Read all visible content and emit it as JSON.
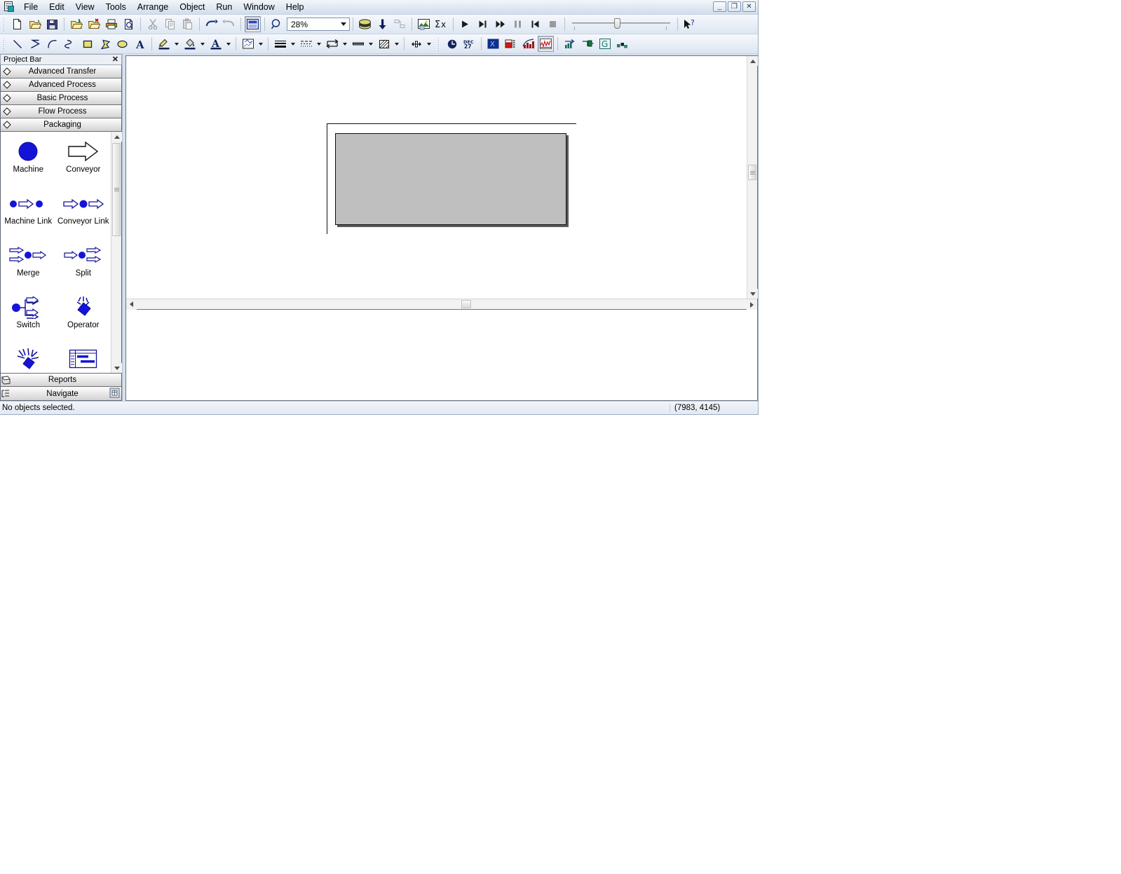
{
  "window": {
    "app_icon": "app-document-icon",
    "minimize_label": "_",
    "restore_label": "❐",
    "close_label": "✕"
  },
  "menubar": {
    "items": [
      {
        "label": "File"
      },
      {
        "label": "Edit"
      },
      {
        "label": "View"
      },
      {
        "label": "Tools"
      },
      {
        "label": "Arrange"
      },
      {
        "label": "Object"
      },
      {
        "label": "Run"
      },
      {
        "label": "Window"
      },
      {
        "label": "Help"
      }
    ]
  },
  "standard_toolbar": {
    "buttons": [
      {
        "name": "new-icon",
        "tip": "New"
      },
      {
        "name": "open-icon",
        "tip": "Open"
      },
      {
        "name": "save-icon",
        "tip": "Save"
      },
      {
        "name": "attach-file-icon",
        "tip": "Attach"
      },
      {
        "name": "detach-file-icon",
        "tip": "Detach"
      },
      {
        "name": "print-icon",
        "tip": "Print"
      },
      {
        "name": "print-preview-icon",
        "tip": "Print Preview"
      },
      {
        "name": "cut-icon",
        "tip": "Cut"
      },
      {
        "name": "copy-icon",
        "tip": "Copy"
      },
      {
        "name": "paste-icon",
        "tip": "Paste"
      },
      {
        "name": "undo-icon",
        "tip": "Undo"
      },
      {
        "name": "redo-icon",
        "tip": "Redo"
      },
      {
        "name": "view-window-icon",
        "tip": "Named View"
      },
      {
        "name": "zoom-icon",
        "tip": "Zoom"
      }
    ],
    "zoom_value": "28%",
    "zoom_dropdown": "chevron-down-icon"
  },
  "run_toolbar": {
    "buttons": [
      {
        "name": "layers-icon",
        "tip": "Layers"
      },
      {
        "name": "arrow-down-icon",
        "tip": "Submodel"
      },
      {
        "name": "connect-icon",
        "tip": "Connect"
      },
      {
        "name": "animate-picture-icon",
        "tip": "Animate"
      },
      {
        "name": "sigma-x-icon",
        "tip": "Expression Builder"
      },
      {
        "name": "play-icon",
        "tip": "Go"
      },
      {
        "name": "step-icon",
        "tip": "Step"
      },
      {
        "name": "fast-forward-icon",
        "tip": "Fast-Forward"
      },
      {
        "name": "pause-icon",
        "tip": "Pause"
      },
      {
        "name": "start-over-icon",
        "tip": "Start Over"
      },
      {
        "name": "stop-icon",
        "tip": "End"
      },
      {
        "name": "speed-slider",
        "tip": "Animation Speed"
      },
      {
        "name": "help-pointer-icon",
        "tip": "Context Help"
      }
    ]
  },
  "draw_toolbar": {
    "buttons": [
      {
        "name": "line-icon",
        "tip": "Line"
      },
      {
        "name": "polyline-icon",
        "tip": "Polyline"
      },
      {
        "name": "arc-icon",
        "tip": "Arc"
      },
      {
        "name": "bezier-icon",
        "tip": "Bezier"
      },
      {
        "name": "rectangle-icon",
        "tip": "Box"
      },
      {
        "name": "polygon-icon",
        "tip": "Polygon"
      },
      {
        "name": "ellipse-icon",
        "tip": "Ellipse"
      },
      {
        "name": "text-icon",
        "tip": "Text"
      },
      {
        "name": "line-color-icon",
        "tip": "Line Color"
      },
      {
        "name": "fill-color-icon",
        "tip": "Fill Color"
      },
      {
        "name": "text-color-icon",
        "tip": "Text Color"
      },
      {
        "name": "window-color-icon",
        "tip": "Window Background Color"
      },
      {
        "name": "line-width-icon",
        "tip": "Line Width"
      },
      {
        "name": "line-style-icon",
        "tip": "Line Style"
      },
      {
        "name": "arrow-style-icon",
        "tip": "Arrow Style"
      },
      {
        "name": "line-end-icon",
        "tip": "Line Ends"
      },
      {
        "name": "fill-pattern-icon",
        "tip": "Fill Pattern"
      },
      {
        "name": "text-align-icon",
        "tip": "Text Alignment"
      }
    ]
  },
  "animate_toolbar": {
    "buttons": [
      {
        "name": "clock-icon",
        "tip": "Clock"
      },
      {
        "name": "calendar-icon",
        "tip": "Date"
      },
      {
        "name": "variable-icon",
        "tip": "Variable"
      },
      {
        "name": "level-icon",
        "tip": "Level"
      },
      {
        "name": "histogram-icon",
        "tip": "Histogram"
      },
      {
        "name": "plot-icon",
        "tip": "Plot"
      },
      {
        "name": "queue-icon",
        "tip": "Queue"
      },
      {
        "name": "resource-icon",
        "tip": "Resource"
      },
      {
        "name": "global-icon",
        "tip": "Global"
      },
      {
        "name": "storage-icon",
        "tip": "Storage"
      }
    ]
  },
  "project_bar": {
    "title": "Project Bar",
    "close_icon": "close-icon",
    "panels": [
      {
        "label": "Advanced Transfer",
        "icon": "diamond-icon"
      },
      {
        "label": "Advanced Process",
        "icon": "diamond-icon"
      },
      {
        "label": "Basic Process",
        "icon": "diamond-icon"
      },
      {
        "label": "Flow Process",
        "icon": "diamond-icon"
      },
      {
        "label": "Packaging",
        "icon": "diamond-icon"
      }
    ],
    "shapes": [
      {
        "label": "Machine",
        "icon": "machine-circle-icon"
      },
      {
        "label": "Conveyor",
        "icon": "conveyor-arrow-icon"
      },
      {
        "label": "Machine Link",
        "icon": "machine-link-icon"
      },
      {
        "label": "Conveyor Link",
        "icon": "conveyor-link-icon"
      },
      {
        "label": "Merge",
        "icon": "merge-icon"
      },
      {
        "label": "Split",
        "icon": "split-icon"
      },
      {
        "label": "Switch",
        "icon": "switch-icon"
      },
      {
        "label": "Operator",
        "icon": "operator-icon"
      },
      {
        "label": "",
        "icon": "robot-icon"
      },
      {
        "label": "",
        "icon": "schedule-icon"
      }
    ],
    "footers": [
      {
        "label": "Reports",
        "icon": "reports-icon"
      },
      {
        "label": "Navigate",
        "icon": "navigate-icon",
        "extra_icon": "navigate-panel-icon"
      }
    ]
  },
  "status_bar": {
    "message": "No objects selected.",
    "coordinates": "(7983, 4145)"
  }
}
